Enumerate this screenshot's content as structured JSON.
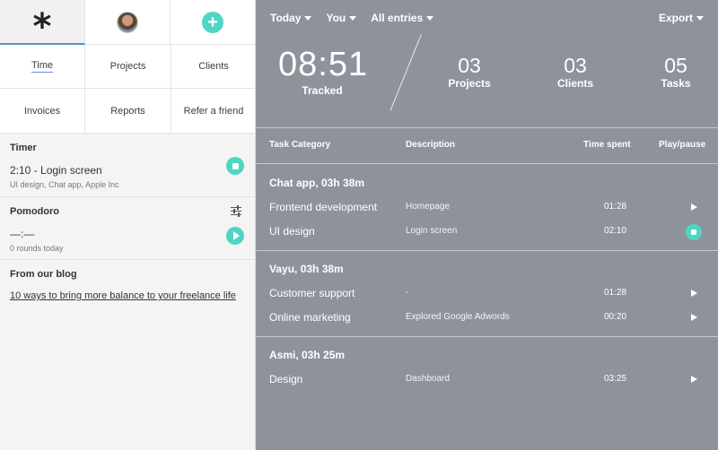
{
  "left": {
    "top_icons": [
      "asterisk-icon",
      "user-avatar",
      "plus-icon"
    ],
    "top_glyphs": {
      "asterisk": "*",
      "plus": "+"
    },
    "nav": [
      {
        "label": "Time",
        "active": true
      },
      {
        "label": "Projects"
      },
      {
        "label": "Clients"
      },
      {
        "label": "Invoices"
      },
      {
        "label": "Reports"
      },
      {
        "label": "Refer a friend"
      }
    ],
    "timer": {
      "title": "Timer",
      "current": "2:10 - Login screen",
      "meta": "UI design, Chat app, Apple Inc"
    },
    "pomodoro": {
      "title": "Pomodoro",
      "value": "—:—",
      "meta": "0 rounds today"
    },
    "blog": {
      "title": "From our blog",
      "link": "10 ways to bring more balance to your freelance life"
    }
  },
  "right": {
    "filters": {
      "period": "Today",
      "user": "You",
      "entries": "All entries",
      "export": "Export"
    },
    "tracked": {
      "value": "08:51",
      "label": "Tracked"
    },
    "stats": [
      {
        "value": "03",
        "label": "Projects"
      },
      {
        "value": "03",
        "label": "Clients"
      },
      {
        "value": "05",
        "label": "Tasks"
      }
    ],
    "table": {
      "headers": {
        "category": "Task Category",
        "description": "Description",
        "time": "Time spent",
        "action": "Play/pause"
      },
      "groups": [
        {
          "title": "Chat app, 03h 38m",
          "rows": [
            {
              "task": "Frontend development",
              "description": "Homepage",
              "time": "01:28",
              "state": "play"
            },
            {
              "task": "UI design",
              "description": "Login screen",
              "time": "02:10",
              "state": "stop"
            }
          ]
        },
        {
          "title": "Vayu, 03h 38m",
          "rows": [
            {
              "task": "Customer support",
              "description": "-",
              "time": "01:28",
              "state": "play"
            },
            {
              "task": "Online marketing",
              "description": "Explored Google Adwords",
              "time": "00:20",
              "state": "play"
            }
          ]
        },
        {
          "title": "Asmi, 03h 25m",
          "rows": [
            {
              "task": "Design",
              "description": "Dashboard",
              "time": "03:25",
              "state": "play"
            }
          ]
        }
      ]
    }
  },
  "colors": {
    "accent": "#4fd5c4",
    "panel": "#8e939b",
    "underline": "#5a8ed8"
  }
}
